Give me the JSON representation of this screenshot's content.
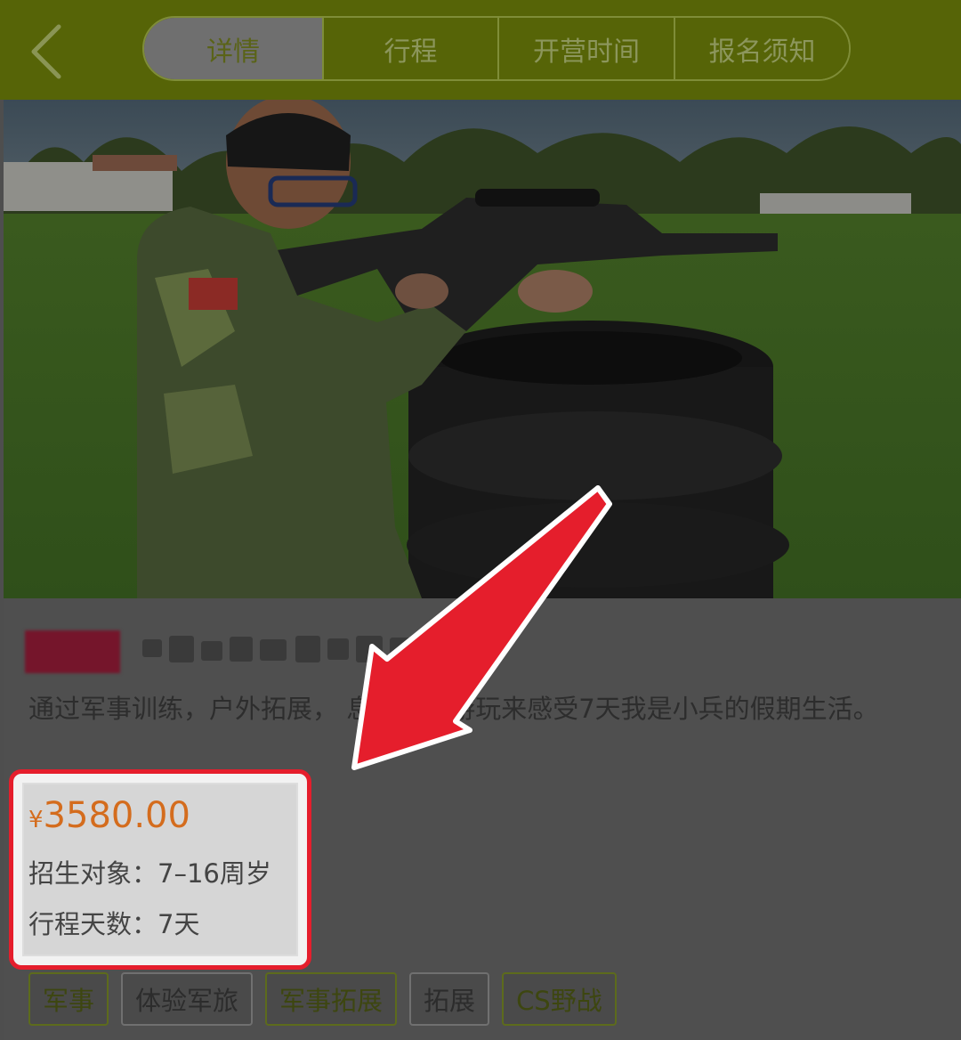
{
  "header": {
    "back_icon": "chevron-left-icon",
    "tabs": [
      {
        "label": "详情"
      },
      {
        "label": "行程"
      },
      {
        "label": "开营时间"
      },
      {
        "label": "报名须知"
      }
    ],
    "bg_color": "#566407"
  },
  "hero": {
    "image_icon": "photo-kid-aiming-rifle-behind-tires"
  },
  "product": {
    "description": "通过军事训练，户外拓展，    息，外出游玩来感受7天我是小兵的假期生活。",
    "price_symbol": "¥",
    "price": "3580.00",
    "age_label": "招生对象：7–16周岁",
    "days_label": "行程天数：7天",
    "price_color": "#d46c1d"
  },
  "tags": [
    {
      "label": "军事"
    },
    {
      "label": "体验军旅"
    },
    {
      "label": "军事拓展"
    },
    {
      "label": "拓展"
    },
    {
      "label": "CS野战"
    }
  ],
  "annotation": {
    "arrow_icon": "red-arrow-icon",
    "highlight_color": "#e51e2c"
  }
}
